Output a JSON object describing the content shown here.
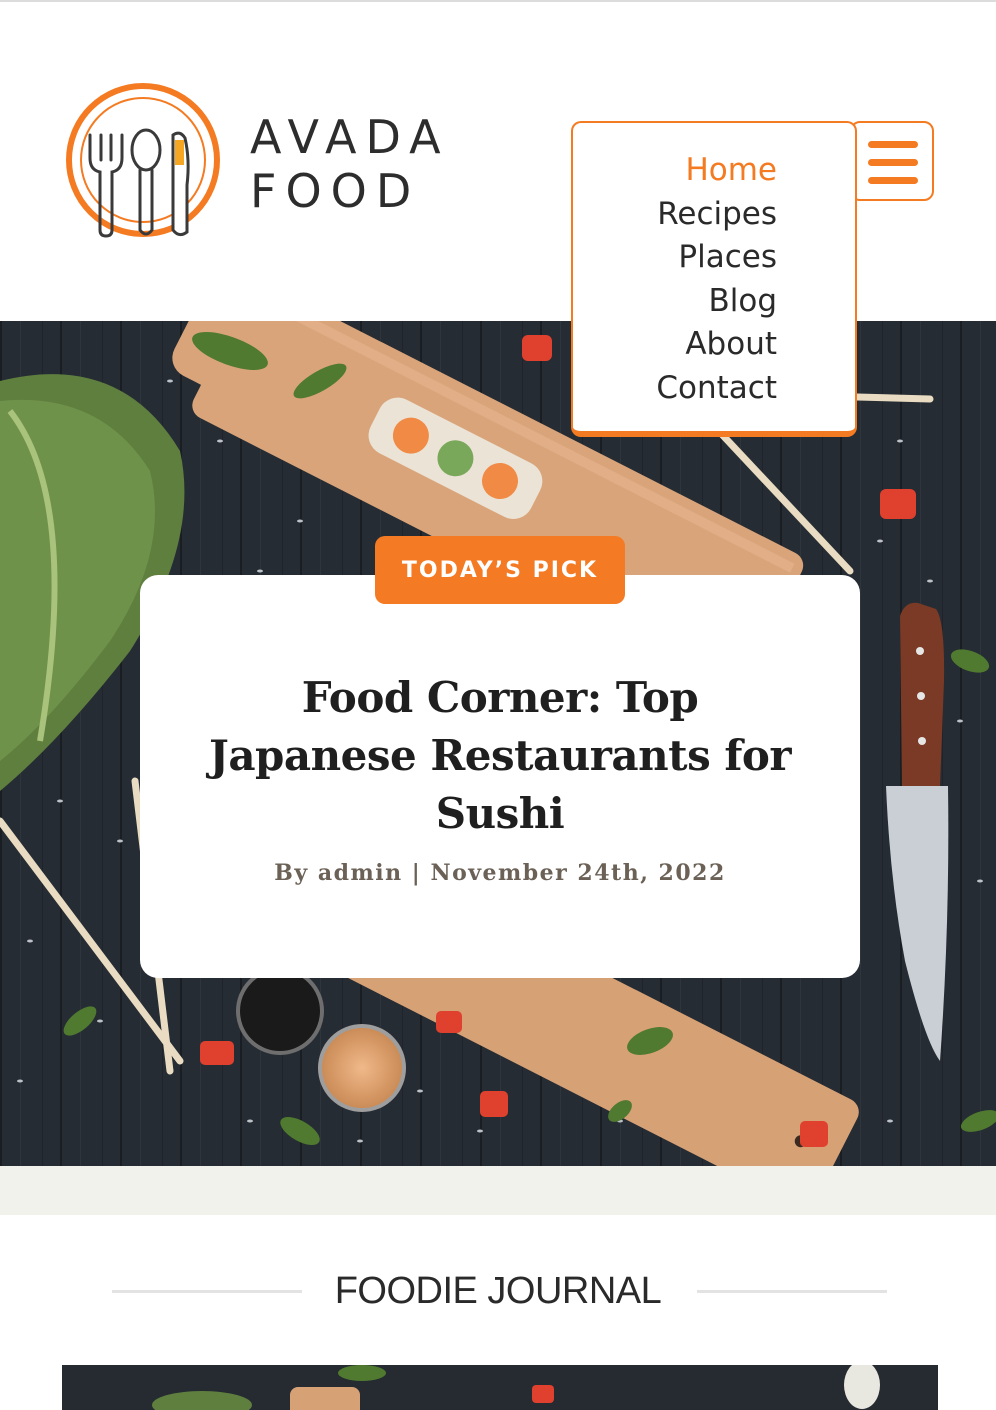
{
  "site": {
    "logo_line1": "AVADA",
    "logo_line2": "FOOD"
  },
  "nav": {
    "items": [
      "Home",
      "Recipes",
      "Places",
      "Blog",
      "About",
      "Contact"
    ],
    "active": "Home",
    "toggle_icon": "hamburger-menu-icon"
  },
  "hero": {
    "badge": "TODAY’S PICK",
    "title_line1": "Food Corner: Top",
    "title_line2": "Japanese Restaurants for",
    "title_line3": "Sushi",
    "meta_prefix": "By",
    "author": "admin",
    "separator": "|",
    "date": "November 24th, 2022"
  },
  "section": {
    "title": "FOODIE JOURNAL"
  },
  "colors": {
    "accent": "#f47b22",
    "text": "#2a2a2a",
    "meta": "#6b6156",
    "band": "#f2f2ec",
    "hero_bg": "#23282e"
  }
}
